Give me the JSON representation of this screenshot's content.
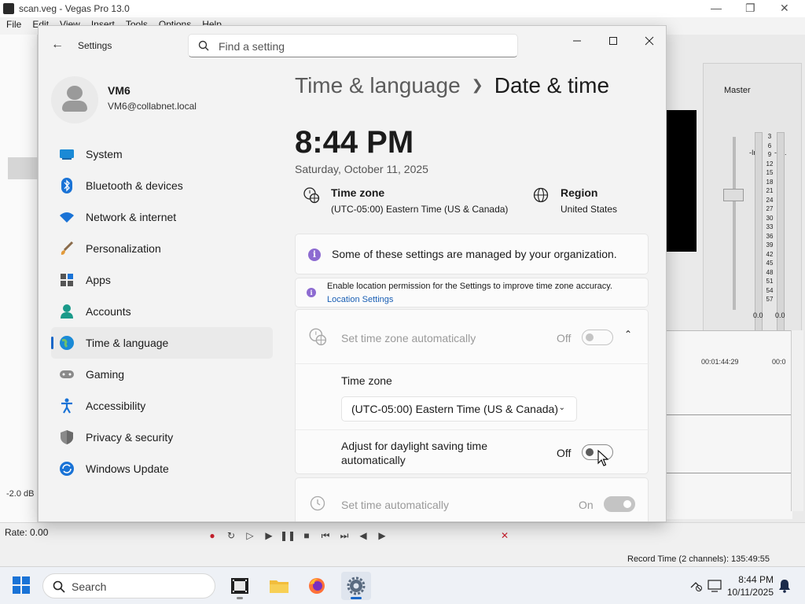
{
  "vegas": {
    "title": "scan.veg - Vegas Pro 13.0",
    "menu": [
      "File",
      "Edit",
      "View",
      "Insert",
      "Tools",
      "Options",
      "Help"
    ],
    "master_label": "Master",
    "inf_left": "-Inf.",
    "inf_right": "-Inf.",
    "meter_scale": [
      "3",
      "6",
      "9",
      "12",
      "15",
      "18",
      "21",
      "24",
      "27",
      "30",
      "33",
      "36",
      "39",
      "42",
      "45",
      "48",
      "51",
      "54",
      "57"
    ],
    "meter_bottom_left": "0.0",
    "meter_bottom_right": "0.0",
    "timecode_1": "00:01:44:29",
    "timecode_2": "00:0",
    "rate": "Rate: 0.00",
    "record_time": "Record Time (2 channels): 135:49:55",
    "db_label": "-2.0 dB"
  },
  "taskbar": {
    "search_label": "Search",
    "time": "8:44 PM",
    "date": "10/11/2025"
  },
  "settings": {
    "app_title": "Settings",
    "search_placeholder": "Find a setting",
    "user": {
      "name": "VM6",
      "email": "VM6@collabnet.local"
    },
    "nav": [
      {
        "label": "System",
        "icon": "monitor-icon"
      },
      {
        "label": "Bluetooth & devices",
        "icon": "bluetooth-icon"
      },
      {
        "label": "Network & internet",
        "icon": "wifi-icon"
      },
      {
        "label": "Personalization",
        "icon": "brush-icon"
      },
      {
        "label": "Apps",
        "icon": "apps-icon"
      },
      {
        "label": "Accounts",
        "icon": "person-icon"
      },
      {
        "label": "Time & language",
        "icon": "globe-clock-icon",
        "selected": true
      },
      {
        "label": "Gaming",
        "icon": "gamepad-icon"
      },
      {
        "label": "Accessibility",
        "icon": "accessibility-icon"
      },
      {
        "label": "Privacy & security",
        "icon": "shield-icon"
      },
      {
        "label": "Windows Update",
        "icon": "update-icon"
      }
    ],
    "breadcrumb": {
      "parent": "Time & language",
      "current": "Date & time"
    },
    "current_time": "8:44 PM",
    "current_date": "Saturday, October 11, 2025",
    "timezone": {
      "title": "Time zone",
      "value": "(UTC-05:00) Eastern Time (US & Canada)"
    },
    "region": {
      "title": "Region",
      "value": "United States"
    },
    "managed_notice": "Some of these settings are managed by your organization.",
    "location_notice": "Enable location permission for the Settings to improve time zone accuracy.",
    "location_link": "Location Settings",
    "set_tz_auto": {
      "label": "Set time zone automatically",
      "state": "Off"
    },
    "tz_section_label": "Time zone",
    "tz_dropdown_value": "(UTC-05:00) Eastern Time (US & Canada)",
    "dst": {
      "label_line1": "Adjust for daylight saving time",
      "label_line2": "automatically",
      "state": "Off"
    },
    "set_time_auto": {
      "label": "Set time automatically",
      "state": "On"
    }
  },
  "colors": {
    "accent": "#1a67c8",
    "info": "#8d6bd1"
  }
}
